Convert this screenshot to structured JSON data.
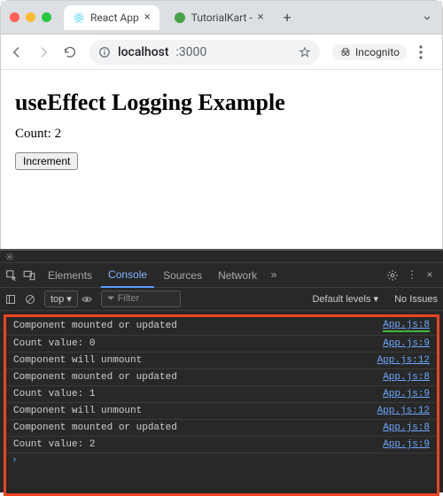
{
  "tabs": [
    {
      "label": "React App",
      "active": true
    },
    {
      "label": "TutorialKart - ",
      "active": false
    }
  ],
  "url": {
    "host": "localhost",
    "path": ":3000"
  },
  "incognito_label": "Incognito",
  "page": {
    "heading": "useEffect Logging Example",
    "count_label": "Count: 2",
    "button_label": "Increment"
  },
  "devtools": {
    "tabs": [
      "Elements",
      "Console",
      "Sources",
      "Network"
    ],
    "selected_tab": "Console",
    "top_label": "top",
    "filter_placeholder": "Filter",
    "levels_label": "Default levels",
    "issues_label": "No Issues"
  },
  "console": [
    {
      "msg": "Component mounted or updated",
      "src": "App.js:8"
    },
    {
      "msg": "Count value: 0",
      "src": "App.js:9"
    },
    {
      "msg": "Component will unmount",
      "src": "App.js:12"
    },
    {
      "msg": "Component mounted or updated",
      "src": "App.js:8"
    },
    {
      "msg": "Count value: 1",
      "src": "App.js:9"
    },
    {
      "msg": "Component will unmount",
      "src": "App.js:12"
    },
    {
      "msg": "Component mounted or updated",
      "src": "App.js:8"
    },
    {
      "msg": "Count value: 2",
      "src": "App.js:9"
    }
  ]
}
